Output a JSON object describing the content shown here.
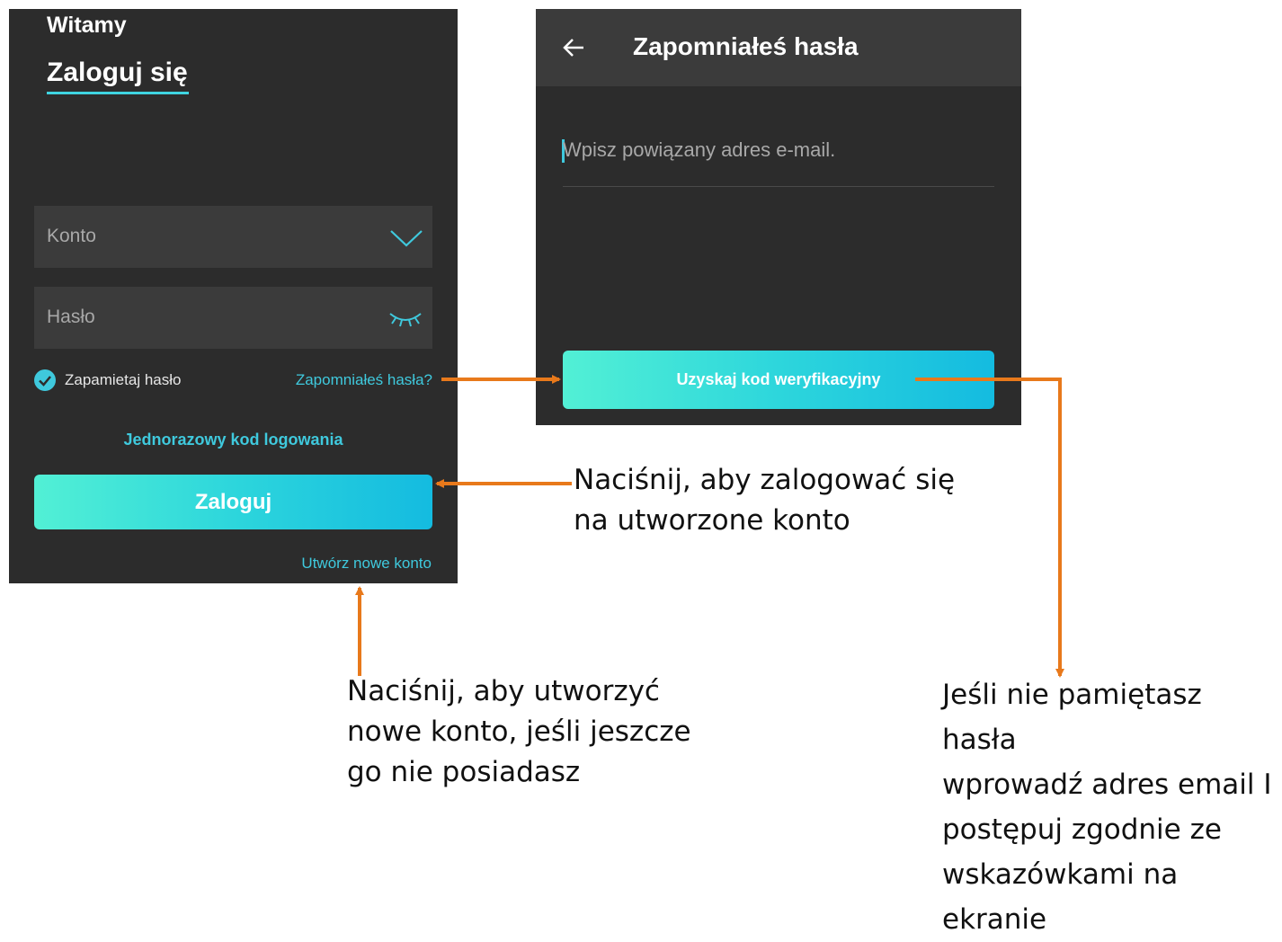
{
  "login": {
    "welcome": "Witamy",
    "title": "Zaloguj się",
    "account_field_label": "Konto",
    "password_field_label": "Hasło",
    "remember_label": "Zapamietaj hasło",
    "forgot_link": "Zapomniałeś hasła?",
    "otp_link": "Jednorazowy kod logowania",
    "login_button": "Zaloguj",
    "create_account_link": "Utwórz nowe konto"
  },
  "forgot": {
    "title": "Zapomniałeś hasła",
    "email_placeholder": "Wpisz powiązany adres e-mail.",
    "code_button": "Uzyskaj kod weryfikacyjny"
  },
  "annotations": {
    "login_note_line1": "Naciśnij, aby zalogować się",
    "login_note_line2": "na utworzone konto",
    "create_note_line1": "Naciśnij, aby utworzyć",
    "create_note_line2": "nowe konto, jeśli jeszcze",
    "create_note_line3": "go nie posiadasz",
    "forgot_note_line1": "Jeśli nie pamiętasz hasła",
    "forgot_note_line2": "wprowadź adres email I",
    "forgot_note_line3": "postępuj zgodnie ze",
    "forgot_note_line4": "wskazówkami na ekranie"
  },
  "icons": {
    "account_dropdown": "chevron-down-icon",
    "password_visibility": "eye-closed-icon",
    "remember_check": "check-circle-icon",
    "back": "arrow-left-icon"
  },
  "colors": {
    "accent": "#3fc9dd",
    "annotation_arrow": "#e8791b",
    "panel_background": "#2c2c2c",
    "field_background": "#3b3b3b"
  }
}
